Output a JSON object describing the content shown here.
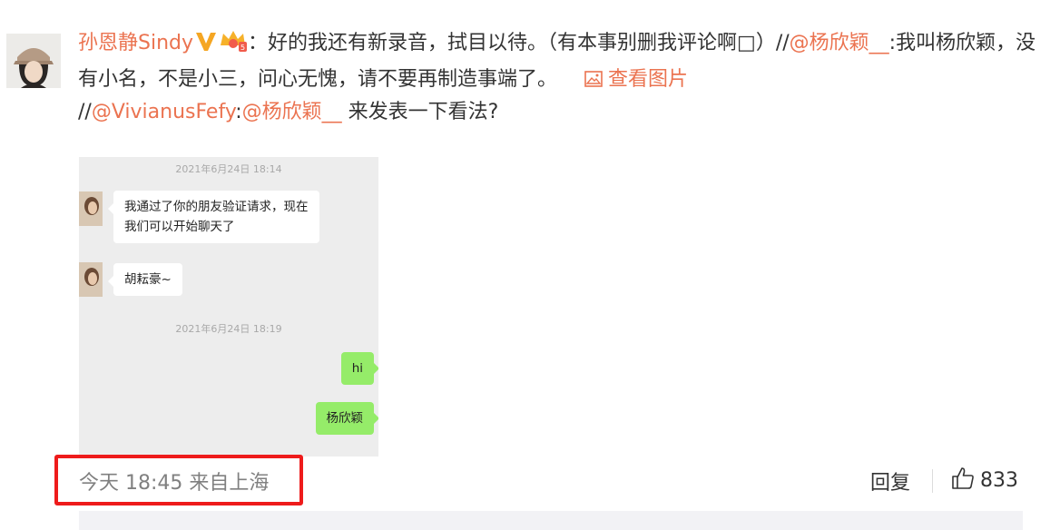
{
  "comment": {
    "username": "孙恩静Sindy",
    "colon": "：",
    "text": "好的我还有新录音，拭目以待。（有本事别删我评论啊□）//",
    "mention1": "@杨欣颖__",
    "text2": ":我叫杨欣颖，没有小名，不是小三，问心无愧，请不要再制造事端了。",
    "view_picture": "查看图片",
    "prefix3": "//",
    "mention2": "@VivianusFefy",
    "sep3": ":",
    "mention3": "@杨欣颖__",
    "text3": " 来发表一下看法?"
  },
  "chat_screenshot": {
    "timestamp1": "2021年6月24日 18:14",
    "msg1_line1": "我通过了你的朋友验证请求，现在",
    "msg1_line2": "我们可以开始聊天了",
    "msg2": "胡耘豪~",
    "timestamp2": "2021年6月24日 18:19",
    "msg3": "hi",
    "msg4": "杨欣颖"
  },
  "footer": {
    "time_source": "今天 18:45 来自上海",
    "reply_label": "回复",
    "like_count": "833"
  },
  "colors": {
    "link": "#eb7350",
    "highlight_box": "#ee1b1b",
    "chat_bg": "#ededed",
    "bubble_green": "#95ec69"
  }
}
